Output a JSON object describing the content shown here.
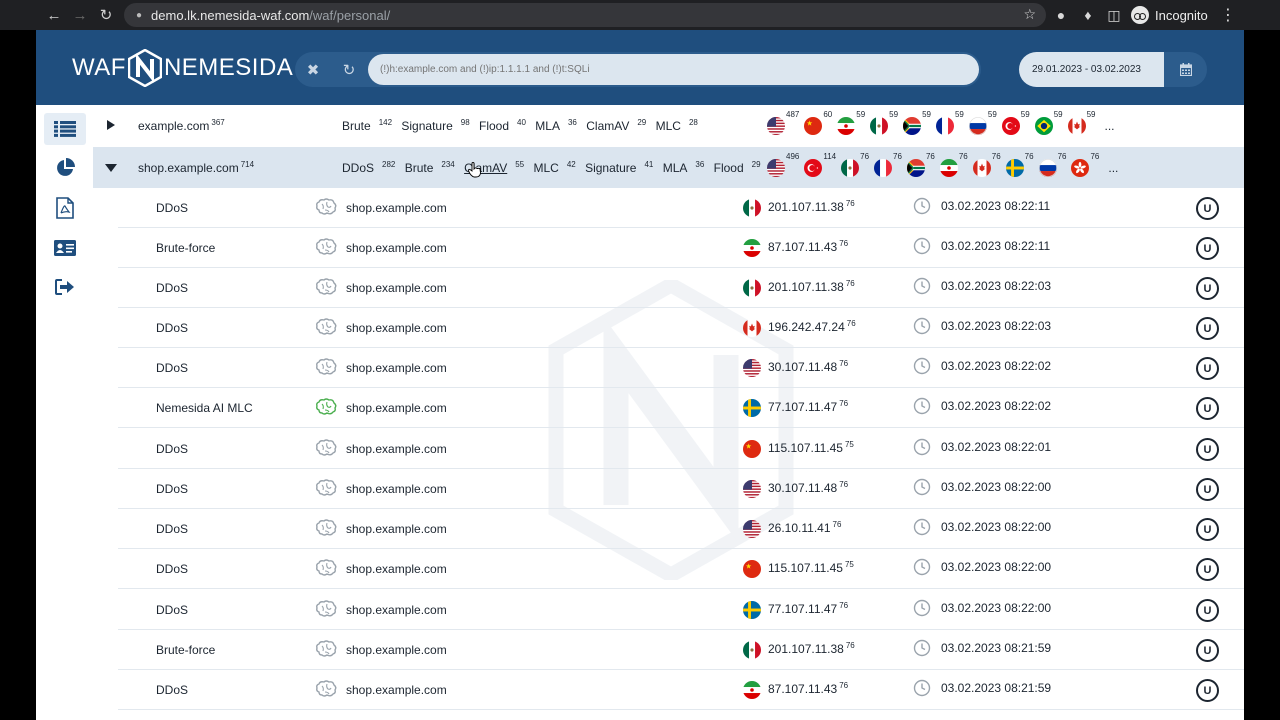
{
  "browser": {
    "url_host": "demo.lk.nemesida-waf.com",
    "url_path": "/waf/personal/",
    "profile_label": "Incognito"
  },
  "header": {
    "logo_left": "WAF",
    "logo_right": "NEMESIDA",
    "search_placeholder": "(!)h:example.com and (!)ip:1.1.1.1 and (!)t:SQLi",
    "date_range": "29.01.2023 - 03.02.2023"
  },
  "colors": {
    "header_bg": "#1f4e7e",
    "expanded_row_bg": "#dbe5ef",
    "ml_green": "#4caf50"
  },
  "sidebar": {
    "items": [
      {
        "icon": "list-icon",
        "active": true
      },
      {
        "icon": "pie-chart-icon",
        "active": false
      },
      {
        "icon": "pdf-icon",
        "active": false
      },
      {
        "icon": "id-card-icon",
        "active": false
      },
      {
        "icon": "logout-icon",
        "active": false
      }
    ]
  },
  "summary_rows": [
    {
      "domain": "example.com",
      "count": "367",
      "expanded": false,
      "attacks": [
        {
          "name": "Brute",
          "count": "142"
        },
        {
          "name": "Signature",
          "count": "98"
        },
        {
          "name": "Flood",
          "count": "40"
        },
        {
          "name": "MLA",
          "count": "36"
        },
        {
          "name": "ClamAV",
          "count": "29"
        },
        {
          "name": "MLC",
          "count": "28"
        }
      ],
      "countries": [
        {
          "flag": "us",
          "count": "487"
        },
        {
          "flag": "cn",
          "count": "60"
        },
        {
          "flag": "ir",
          "count": "59"
        },
        {
          "flag": "mx",
          "count": "59"
        },
        {
          "flag": "za",
          "count": "59"
        },
        {
          "flag": "fr",
          "count": "59"
        },
        {
          "flag": "ru",
          "count": "59"
        },
        {
          "flag": "tr",
          "count": "59"
        },
        {
          "flag": "br",
          "count": "59"
        },
        {
          "flag": "ca",
          "count": "59"
        }
      ],
      "more": "..."
    },
    {
      "domain": "shop.example.com",
      "count": "714",
      "expanded": true,
      "attacks": [
        {
          "name": "DDoS",
          "count": "282"
        },
        {
          "name": "Brute",
          "count": "234"
        },
        {
          "name": "ClamAV",
          "count": "55"
        },
        {
          "name": "MLC",
          "count": "42"
        },
        {
          "name": "Signature",
          "count": "41"
        },
        {
          "name": "MLA",
          "count": "36"
        },
        {
          "name": "Flood",
          "count": "29"
        }
      ],
      "countries": [
        {
          "flag": "us",
          "count": "496"
        },
        {
          "flag": "tr",
          "count": "114"
        },
        {
          "flag": "mx",
          "count": "76"
        },
        {
          "flag": "fr",
          "count": "76"
        },
        {
          "flag": "za",
          "count": "76"
        },
        {
          "flag": "ir",
          "count": "76"
        },
        {
          "flag": "ca",
          "count": "76"
        },
        {
          "flag": "se",
          "count": "76"
        },
        {
          "flag": "ru",
          "count": "76"
        },
        {
          "flag": "hk",
          "count": "76"
        }
      ],
      "more": "..."
    }
  ],
  "detail_rows": [
    {
      "type": "DDoS",
      "ml": false,
      "host": "shop.example.com",
      "flag": "mx",
      "ip": "201.107.11.38",
      "score": "76",
      "time": "03.02.2023 08:22:11",
      "badge": "U"
    },
    {
      "type": "Brute-force",
      "ml": false,
      "host": "shop.example.com",
      "flag": "ir",
      "ip": "87.107.11.43",
      "score": "76",
      "time": "03.02.2023 08:22:11",
      "badge": "U"
    },
    {
      "type": "DDoS",
      "ml": false,
      "host": "shop.example.com",
      "flag": "mx",
      "ip": "201.107.11.38",
      "score": "76",
      "time": "03.02.2023 08:22:03",
      "badge": "U"
    },
    {
      "type": "DDoS",
      "ml": false,
      "host": "shop.example.com",
      "flag": "ca",
      "ip": "196.242.47.24",
      "score": "76",
      "time": "03.02.2023 08:22:03",
      "badge": "U"
    },
    {
      "type": "DDoS",
      "ml": false,
      "host": "shop.example.com",
      "flag": "us",
      "ip": "30.107.11.48",
      "score": "76",
      "time": "03.02.2023 08:22:02",
      "badge": "U"
    },
    {
      "type": "Nemesida AI MLC",
      "ml": true,
      "host": "shop.example.com",
      "flag": "se",
      "ip": "77.107.11.47",
      "score": "76",
      "time": "03.02.2023 08:22:02",
      "badge": "U"
    },
    {
      "type": "DDoS",
      "ml": false,
      "host": "shop.example.com",
      "flag": "cn",
      "ip": "115.107.11.45",
      "score": "75",
      "time": "03.02.2023 08:22:01",
      "badge": "U"
    },
    {
      "type": "DDoS",
      "ml": false,
      "host": "shop.example.com",
      "flag": "us",
      "ip": "30.107.11.48",
      "score": "76",
      "time": "03.02.2023 08:22:00",
      "badge": "U"
    },
    {
      "type": "DDoS",
      "ml": false,
      "host": "shop.example.com",
      "flag": "us",
      "ip": "26.10.11.41",
      "score": "76",
      "time": "03.02.2023 08:22:00",
      "badge": "U"
    },
    {
      "type": "DDoS",
      "ml": false,
      "host": "shop.example.com",
      "flag": "cn",
      "ip": "115.107.11.45",
      "score": "75",
      "time": "03.02.2023 08:22:00",
      "badge": "U"
    },
    {
      "type": "DDoS",
      "ml": false,
      "host": "shop.example.com",
      "flag": "se",
      "ip": "77.107.11.47",
      "score": "76",
      "time": "03.02.2023 08:22:00",
      "badge": "U"
    },
    {
      "type": "Brute-force",
      "ml": false,
      "host": "shop.example.com",
      "flag": "mx",
      "ip": "201.107.11.38",
      "score": "76",
      "time": "03.02.2023 08:21:59",
      "badge": "U"
    },
    {
      "type": "DDoS",
      "ml": false,
      "host": "shop.example.com",
      "flag": "ir",
      "ip": "87.107.11.43",
      "score": "76",
      "time": "03.02.2023 08:21:59",
      "badge": "U"
    }
  ]
}
